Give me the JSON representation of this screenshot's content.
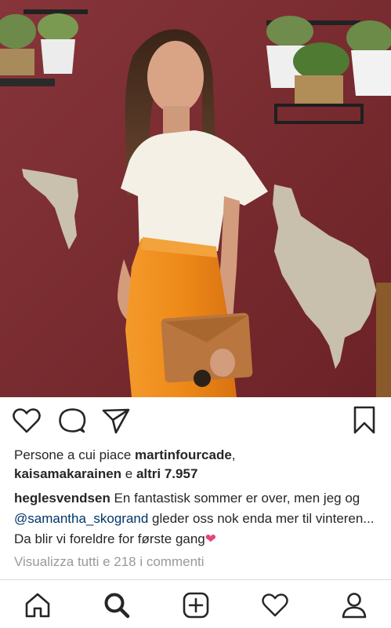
{
  "post": {
    "likes": {
      "prefix": "Persone a cui piace ",
      "user1": "martinfourcade",
      "comma": ",",
      "user2": "kaisamakarainen",
      "conj": " e ",
      "others": "altri 7.957"
    },
    "caption": {
      "author": "heglesvendsen",
      "text1": " En fantastisk sommer er over, men jeg og ",
      "mention": "@samantha_skogrand",
      "text2": " gleder oss nok enda mer til vinteren... Da blir vi foreldre for første gang",
      "emoji": "❤"
    },
    "comments_link": "Visualizza tutti e 218 i commenti"
  },
  "actions": {
    "like": "heart-icon",
    "comment": "comment-icon",
    "share": "paper-plane-icon",
    "save": "bookmark-icon"
  },
  "nav": {
    "items": [
      "home-icon",
      "search-icon",
      "add-post-icon",
      "activity-heart-icon",
      "profile-icon"
    ]
  },
  "colors": {
    "wall": "#7a2a2e",
    "skirt": "#f08a1c",
    "mention": "#003569",
    "muted": "#999999"
  }
}
